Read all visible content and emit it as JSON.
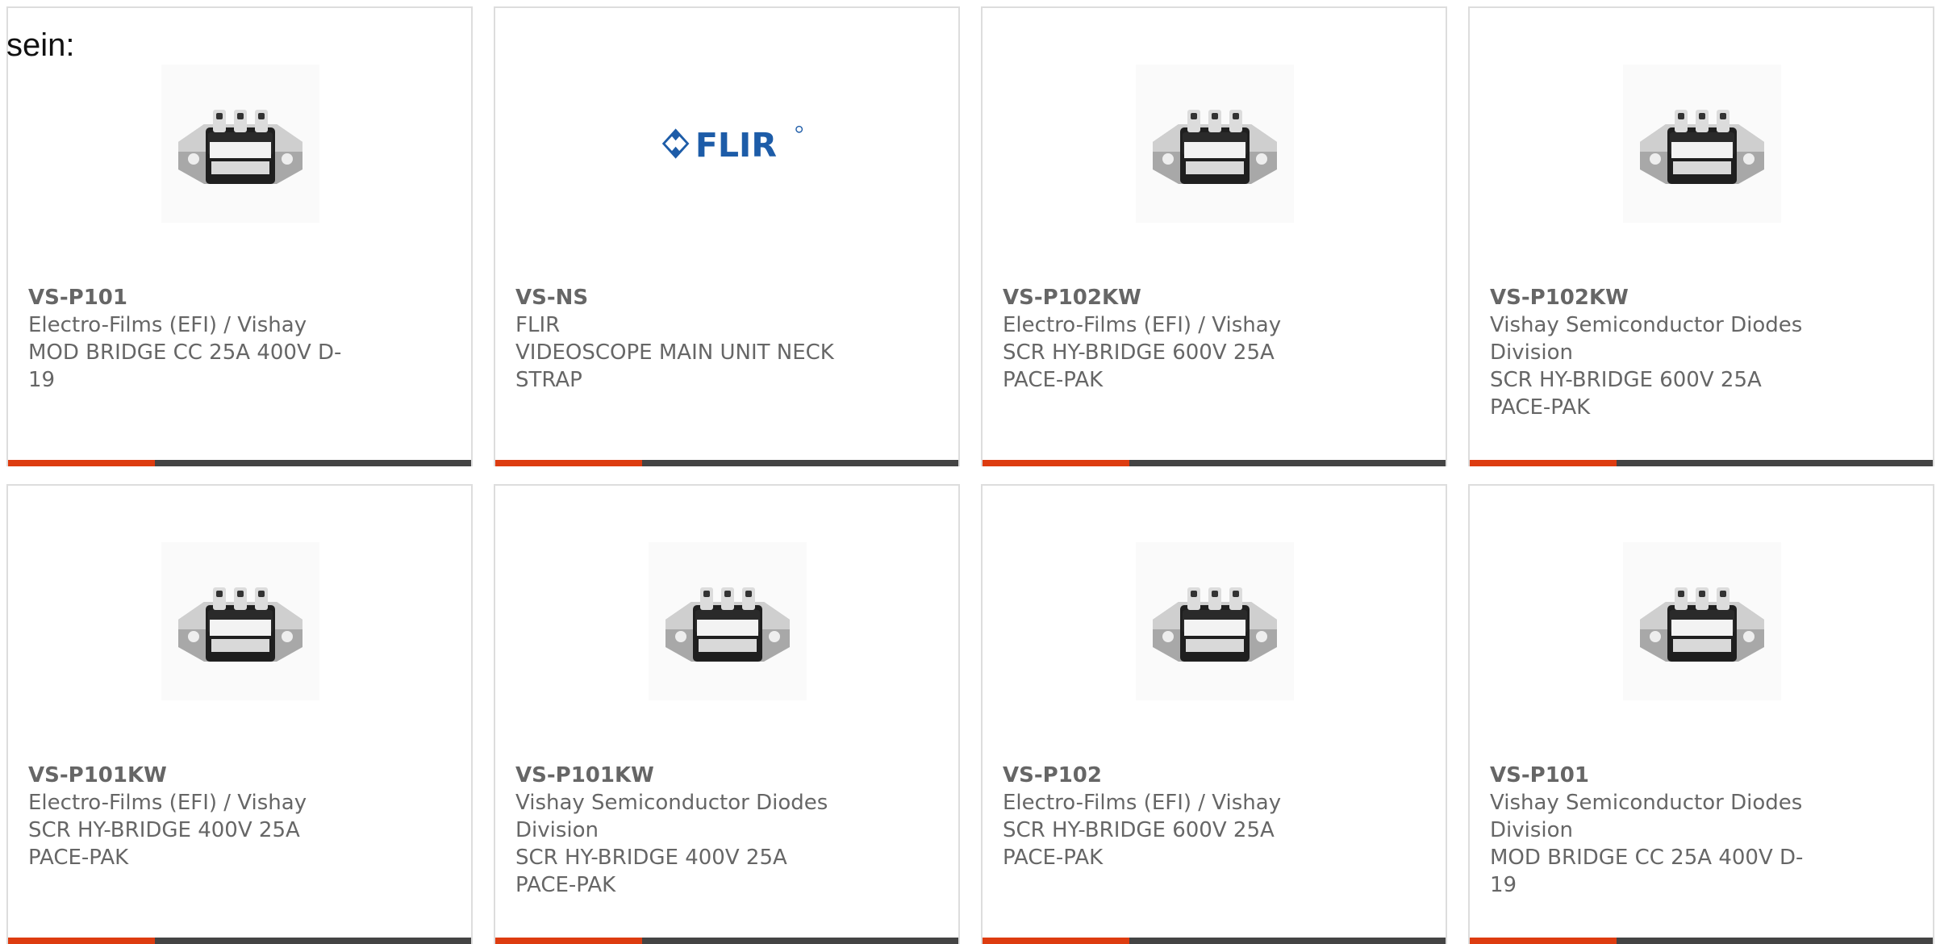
{
  "intro": {
    "text": "sein:"
  },
  "colors": {
    "card_border": "#dddddd",
    "text": "#666666",
    "accent": "#dd3c10",
    "bar": "#444444",
    "flir_blue": "#1d5ca8"
  },
  "products": [
    {
      "part_number": "VS-P101",
      "manufacturer": "Electro-Films (EFI) / Vishay",
      "description": "MOD BRIDGE CC 25A 400V D-19",
      "image": "bridge-rectifier-module-photo"
    },
    {
      "part_number": "VS-NS",
      "manufacturer": "FLIR",
      "description": "VIDEOSCOPE MAIN UNIT NECK STRAP",
      "image": "flir-logo",
      "logo_text": "FLIR"
    },
    {
      "part_number": "VS-P102KW",
      "manufacturer": "Electro-Films (EFI) / Vishay",
      "description": "SCR HY-BRIDGE 600V 25A PACE-PAK",
      "image": "bridge-rectifier-module-photo"
    },
    {
      "part_number": "VS-P102KW",
      "manufacturer": "Vishay Semiconductor Diodes Division",
      "description": "SCR HY-BRIDGE 600V 25A PACE-PAK",
      "image": "bridge-rectifier-module-photo"
    },
    {
      "part_number": "VS-P101KW",
      "manufacturer": "Electro-Films (EFI) / Vishay",
      "description": "SCR HY-BRIDGE 400V 25A PACE-PAK",
      "image": "bridge-rectifier-module-photo"
    },
    {
      "part_number": "VS-P101KW",
      "manufacturer": "Vishay Semiconductor Diodes Division",
      "description": "SCR HY-BRIDGE 400V 25A PACE-PAK",
      "image": "bridge-rectifier-module-photo"
    },
    {
      "part_number": "VS-P102",
      "manufacturer": "Electro-Films (EFI) / Vishay",
      "description": "SCR HY-BRIDGE 600V 25A PACE-PAK",
      "image": "bridge-rectifier-module-photo"
    },
    {
      "part_number": "VS-P101",
      "manufacturer": "Vishay Semiconductor Diodes Division",
      "description": "MOD BRIDGE CC 25A 400V D-19",
      "image": "bridge-rectifier-module-photo"
    }
  ]
}
